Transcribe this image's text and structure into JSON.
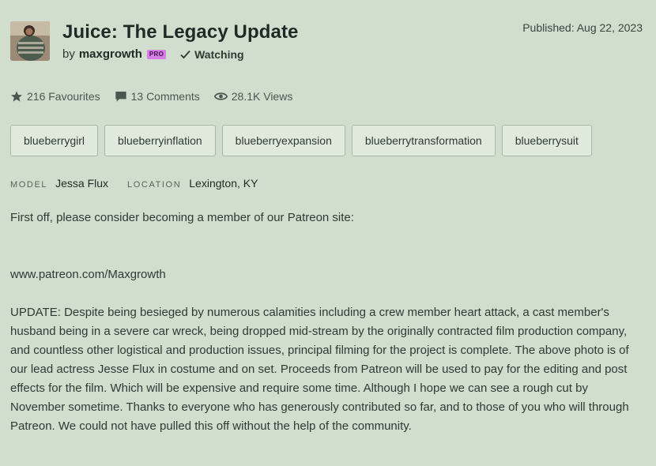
{
  "deviation": {
    "title": "Juice: The Legacy Update",
    "by_prefix": "by",
    "author": "maxgrowth",
    "badge": "PRO",
    "watching_label": "Watching",
    "published": "Published: Aug 22, 2023"
  },
  "stats": {
    "favourites": "216 Favourites",
    "comments": "13 Comments",
    "views": "28.1K Views"
  },
  "tags": [
    "blueberrygirl",
    "blueberryinflation",
    "blueberryexpansion",
    "blueberrytransformation",
    "blueberrysuit"
  ],
  "meta": {
    "model_label": "MODEL",
    "model_value": "Jessa Flux",
    "location_label": "LOCATION",
    "location_value": "Lexington, KY"
  },
  "description": {
    "p1": "First off, please consider becoming a member of our Patreon site:",
    "p2": "www.patreon.com/Maxgrowth",
    "p3": "UPDATE: Despite being besieged by numerous calamities including a crew member heart attack, a cast member's husband being in a severe car wreck, being dropped mid-stream by the originally contracted film production company, and countless other logistical and production issues, principal filming for the project is complete. The above photo is of our lead actress Jesse Flux in costume and on set. Proceeds from Patreon will be used to pay for the editing and post effects for the film. Which will be expensive and require some time. Although I hope we can see a rough cut by November sometime. Thanks to everyone who has generously contributed so far, and to those of you who will through Patreon. We could not have pulled this off without the help of the community."
  },
  "icons": {
    "favourites": "star-icon",
    "comments": "comment-icon",
    "views": "eye-icon",
    "watching": "checkmark-icon"
  }
}
